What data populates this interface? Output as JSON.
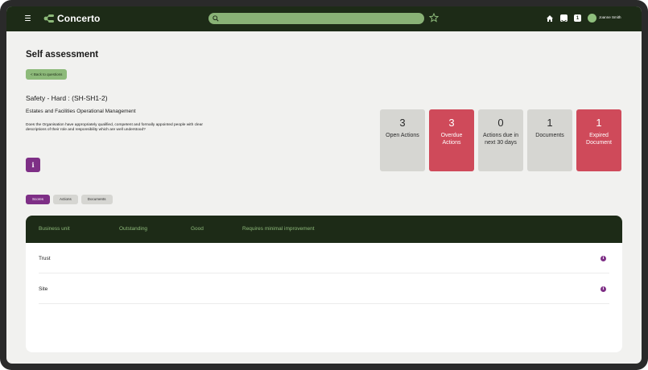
{
  "app": {
    "brand": "Concerto",
    "user_name": "Joanne Smith",
    "colors": {
      "nav": "#1d2b17",
      "accent": "#8dba7a",
      "purple": "#7e2f86",
      "alert": "#cf4a5a"
    }
  },
  "header": {
    "search_placeholder": "",
    "icons": [
      "menu-icon",
      "search-icon",
      "star-icon",
      "home-icon",
      "mail-icon",
      "calendar-icon"
    ],
    "calendar_glyph": "1"
  },
  "page": {
    "title": "Self assessment",
    "back_label": "< Back to questions",
    "question_code": "Safety - Hard : (SH-SH1-2)",
    "question_area": "Estates and Facilities Operational Management",
    "question_text": "Does the Organisation have appropriately qualified, competent and formally appointed people with clear descriptions of their role and responsibility which are well understood?",
    "info_glyph": "i"
  },
  "stats": [
    {
      "value": "3",
      "label": "Open Actions",
      "tone": "grey"
    },
    {
      "value": "3",
      "label": "Overdue Actions",
      "tone": "red"
    },
    {
      "value": "0",
      "label": "Actions due in next 30 days",
      "tone": "grey"
    },
    {
      "value": "1",
      "label": "Documents",
      "tone": "grey"
    },
    {
      "value": "1",
      "label": "Expired Document",
      "tone": "red"
    }
  ],
  "tabs": [
    {
      "label": "Scores",
      "active": true
    },
    {
      "label": "Actions",
      "active": false
    },
    {
      "label": "Documents",
      "active": false
    }
  ],
  "table": {
    "columns": [
      "Business unit",
      "Outstanding",
      "Good",
      "Requires minimal improvement"
    ],
    "rows": [
      {
        "business_unit": "Trust",
        "icon": "i"
      },
      {
        "business_unit": "Site",
        "icon": "i"
      }
    ]
  }
}
